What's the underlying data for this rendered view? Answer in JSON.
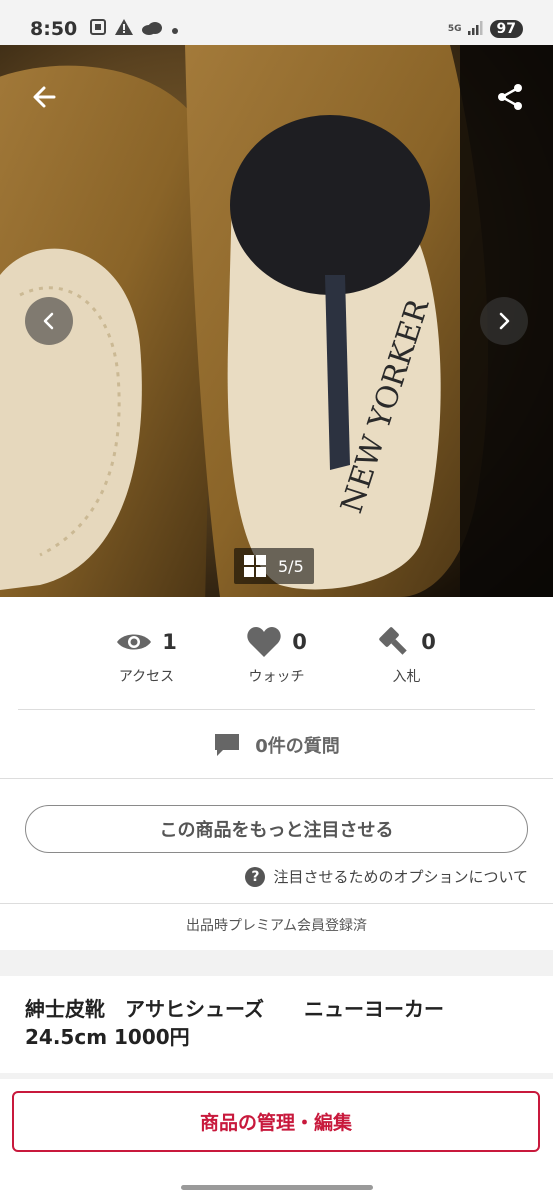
{
  "status_bar": {
    "time": "8:50",
    "network": "5G",
    "battery": "97"
  },
  "photo": {
    "counter": "5/5",
    "brand_imprint": "NEW YORKER"
  },
  "stats": [
    {
      "icon": "eye-icon",
      "count": "1",
      "label": "アクセス"
    },
    {
      "icon": "heart-icon",
      "count": "0",
      "label": "ウォッチ"
    },
    {
      "icon": "gavel-icon",
      "count": "0",
      "label": "入札"
    }
  ],
  "questions": {
    "label": "0件の質問"
  },
  "promote": {
    "button_label": "この商品をもっと注目させる",
    "help_text": "注目させるためのオプションについて"
  },
  "premium_note": "出品時プレミアム会員登録済",
  "item": {
    "title_line1": "紳士皮靴　アサヒシューズ　　ニューヨーカー",
    "title_line2": "24.5cm 1000円"
  },
  "manage_button_label": "商品の管理・編集",
  "colors": {
    "accent": "#c8193c",
    "icon_gray": "#666666"
  }
}
